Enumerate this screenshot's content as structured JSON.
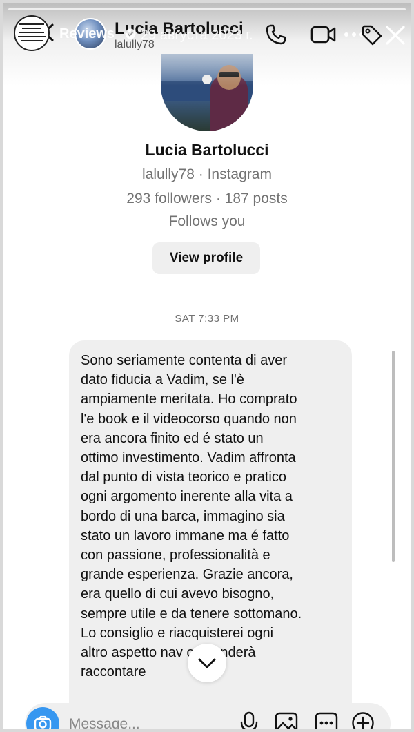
{
  "story": {
    "title": "Reviews",
    "date": "29 августа 2023 г."
  },
  "chat": {
    "name": "Lucia Bartolucci",
    "handle": "lalully78"
  },
  "profile": {
    "name": "Lucia Bartolucci",
    "subtitle": "lalully78 · Instagram",
    "stats": "293 followers · 187 posts",
    "follows": "Follows you",
    "view_profile_label": "View profile"
  },
  "timestamp": "SAT 7:33 PM",
  "message": {
    "text": "Sono seriamente contenta di aver\ndato fiducia a Vadim, se l'è\nampiamente meritata. Ho comprato\nl'e book e il videocorso quando non\nera ancora finito ed é stato un\nottimo investimento. Vadim affronta\ndal punto di vista teorico e pratico\nogni argomento inerente alla vita a\nbordo di una barca, immagino sia\nstato un lavoro immane ma é fatto\ncon passione, professionalità e\ngrande esperienza. Grazie ancora,\nera quello di cui avevo bisogno,\nsempre utile e da tenere sottomano.\nLo consiglio e riacquisterei ogni\naltro aspetto nav    o intenderà\nraccontare"
  },
  "composer": {
    "placeholder": "Message..."
  },
  "colors": {
    "accent": "#3797f0",
    "bubble": "#efefef",
    "muted_text": "#737373"
  }
}
